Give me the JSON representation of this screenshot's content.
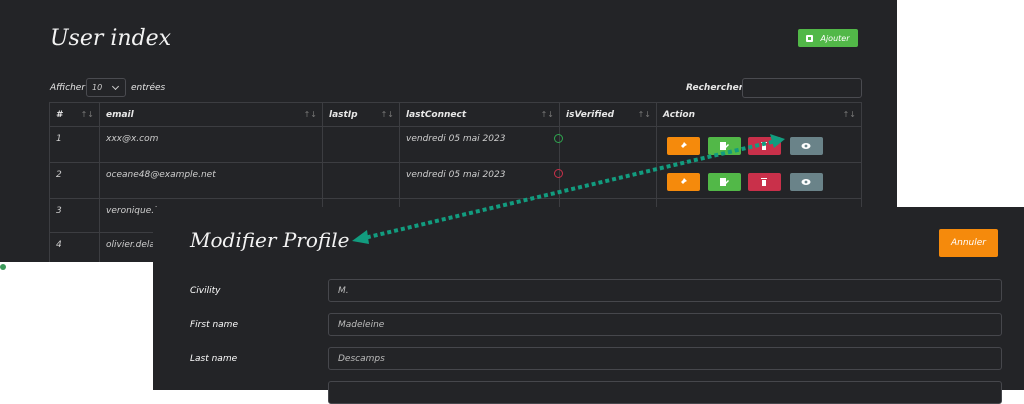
{
  "index": {
    "title": "User index",
    "add_button": "Ajouter",
    "show_label": "Afficher",
    "show_value": "10",
    "entries_label": "entrées",
    "search_label": "Rechercher :",
    "columns": [
      "#",
      "email",
      "lastIp",
      "lastConnect",
      "isVerified",
      "Action"
    ],
    "sort_icon": "↑↓",
    "rows": [
      {
        "num": "1",
        "email": "xxx@x.com",
        "lastIp": "",
        "lastConnect": "vendredi 05 mai 2023",
        "verified": "green"
      },
      {
        "num": "2",
        "email": "oceane48@example.net",
        "lastIp": "",
        "lastConnect": "vendredi 05 mai 2023",
        "verified": "red"
      },
      {
        "num": "3",
        "email": "veronique.le",
        "lastIp": "",
        "lastConnect": ""
      },
      {
        "num": "4",
        "email": "olivier.delat",
        "lastIp": "",
        "lastConnect": ""
      }
    ],
    "action_icons": [
      "pin-icon",
      "edit-icon",
      "trash-icon",
      "eye-icon"
    ]
  },
  "profile": {
    "title": "Modifier Profile",
    "cancel_button": "Annuler",
    "fields": [
      {
        "label": "Civility",
        "value": "M."
      },
      {
        "label": "First name",
        "value": "Madeleine"
      },
      {
        "label": "Last name",
        "value": "Descamps"
      }
    ]
  },
  "colors": {
    "background": "#232427",
    "add_green": "#52b848",
    "orange": "#f58a0c",
    "red": "#c9304a",
    "slate": "#6a8389",
    "arrow": "#129c7f"
  }
}
